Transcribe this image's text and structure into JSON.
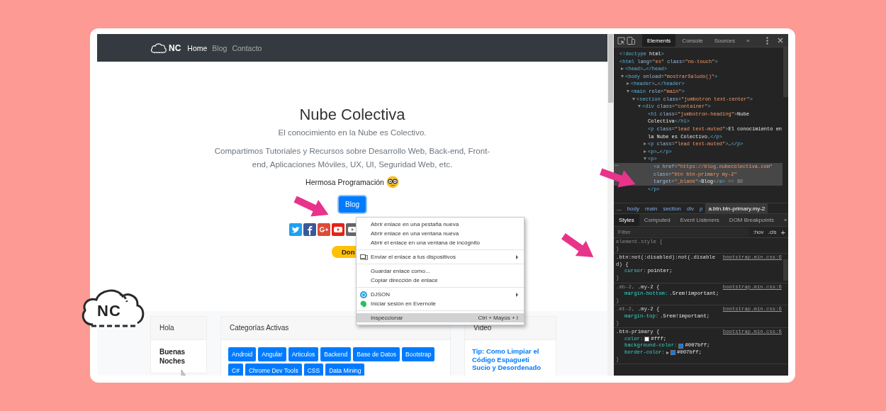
{
  "browser_page": {
    "navbar": {
      "logo_text": "NC",
      "links": [
        {
          "label": "Home",
          "selected": true
        },
        {
          "label": "Blog",
          "selected": false
        },
        {
          "label": "Contacto",
          "selected": false
        }
      ]
    },
    "hero": {
      "title": "Nube Colectiva",
      "subtitle": "El conocimiento en la Nube es Colectivo.",
      "description": "Compartimos Tutoriales y Recursos sobre Desarrollo Web, Back-end, Front-end, Aplicaciones Móviles, UX, UI, Seguridad Web, etc.",
      "greeting": "Hermosa Programación",
      "blog_button": "Blog",
      "donate_button": "Don"
    },
    "cards": [
      {
        "kind": "text",
        "title": "Hola",
        "body": "Buenas Noches"
      },
      {
        "kind": "tags",
        "title": "Categorías Activas",
        "tags": [
          "Android",
          "Angular",
          "Articulos",
          "Backend",
          "Base de Datos",
          "Bootstrap",
          "C#",
          "Chrome Dev Tools",
          "CSS",
          "Data Mining"
        ]
      },
      {
        "kind": "link",
        "title": "Video",
        "link": "Tip: Como Limpiar el Código Espagueti Sucio y Desordenado"
      }
    ]
  },
  "context_menu": {
    "groups": [
      [
        {
          "label": "Abrir enlace en una pestaña nueva",
          "submenu": false,
          "selected": false
        },
        {
          "label": "Abrir enlace en una ventana nueva",
          "submenu": false,
          "selected": false
        },
        {
          "label": "Abrir el enlace en una ventana de incógnito",
          "submenu": false,
          "selected": false
        }
      ],
      [
        {
          "label": "Enviar el enlace a tus dispositivos",
          "submenu": true,
          "selected": false
        }
      ],
      [
        {
          "label": "Guardar enlace como...",
          "submenu": false,
          "selected": false
        },
        {
          "label": "Copiar dirección de enlace",
          "submenu": false,
          "selected": false
        }
      ],
      [
        {
          "label": "DJSON",
          "submenu": true,
          "selected": false
        },
        {
          "label": "Iniciar sesión en Evernote",
          "submenu": false,
          "selected": false
        }
      ],
      [
        {
          "label": "Inspeccionar",
          "shortcut": "Ctrl + Mayús + I",
          "submenu": false,
          "selected": true
        }
      ]
    ]
  },
  "devtools": {
    "tabs": [
      {
        "label": "Elements",
        "selected": true
      },
      {
        "label": "Console",
        "selected": false
      },
      {
        "label": "Sources",
        "selected": false
      }
    ],
    "more_tabs": "»",
    "dom_tree": [
      {
        "markup": "<!doctype html>",
        "selected": false
      },
      {
        "markup": "<html lang=\"es\" class=\"no-touch\">",
        "selected": false,
        "children": [
          {
            "markup": "<head>…</head>",
            "expanded": false,
            "selected": false
          },
          {
            "markup": "<body onload=\"mostrarSaludo()\">",
            "expanded": true,
            "selected": false,
            "children": [
              {
                "markup": "<header>…</header>",
                "expanded": false,
                "selected": false
              },
              {
                "markup": "<main role=\"main\">",
                "expanded": true,
                "selected": false,
                "children": [
                  {
                    "markup": "<section class=\"jumbotron text-center\">",
                    "expanded": true,
                    "selected": false,
                    "children": [
                      {
                        "markup": "<div class=\"container\">",
                        "expanded": true,
                        "selected": false,
                        "children": [
                          {
                            "markup": "<h1 class=\"jumbotron-heading\">Nube Colectiva</h1>",
                            "selected": false
                          },
                          {
                            "markup": "<p class=\"lead text-muted\">El conocimiento en la Nube es Colectivo.</p>",
                            "selected": false
                          },
                          {
                            "markup": "<p class=\"lead text-muted\">…</p>",
                            "expanded": false,
                            "selected": false
                          },
                          {
                            "markup": "<p>…</p>",
                            "expanded": false,
                            "selected": false
                          },
                          {
                            "markup": "<p>",
                            "expanded": true,
                            "selected": false,
                            "closing": "</p>",
                            "children": [
                              {
                                "markup": "<a href=\"https://blog.nubecolectiva.com\" class=\"btn btn-primary my-2\" target=\"_blank\">Blog</a>",
                                "console_ref": "== $0",
                                "selected": true
                              }
                            ]
                          }
                        ]
                      }
                    ]
                  }
                ]
              }
            ]
          }
        ]
      }
    ],
    "breadcrumbs": [
      {
        "label": "...",
        "selected": false
      },
      {
        "label": "body",
        "selected": false
      },
      {
        "label": "main",
        "selected": false
      },
      {
        "label": "section",
        "selected": false
      },
      {
        "label": "div",
        "selected": false
      },
      {
        "label": "p",
        "selected": false
      },
      {
        "label": "a.btn.btn-primary.my-2",
        "selected": true
      }
    ],
    "style_tabs": [
      {
        "label": "Styles",
        "selected": true
      },
      {
        "label": "Computed",
        "selected": false
      },
      {
        "label": "Event Listeners",
        "selected": false
      },
      {
        "label": "DOM Breakpoints",
        "selected": false
      }
    ],
    "more_style_tabs": "»",
    "filter": {
      "placeholder": "Filter",
      "hov": ":hov",
      "cls": ".cls",
      "add": "+"
    },
    "rules": [
      {
        "selector": [
          {
            "text": "element.style {",
            "matched": false
          }
        ],
        "close": "}"
      },
      {
        "selector": [
          {
            "text": ".btn:not(:disabled):not(.disabled) {",
            "matched": true
          }
        ],
        "source": "bootstrap.min.css:6",
        "declarations": [
          {
            "text": "cursor: pointer;",
            "swatch": false,
            "expandable": false
          }
        ],
        "close": "}"
      },
      {
        "selector": [
          {
            "text": ".mb-2,",
            "matched": false
          },
          {
            "text": ".my-2 {",
            "matched": true
          }
        ],
        "source": "bootstrap.min.css:6",
        "declarations": [
          {
            "text": "margin-bottom: .5rem!important;",
            "swatch": false,
            "expandable": false
          }
        ],
        "close": "}"
      },
      {
        "selector": [
          {
            "text": ".mt-2,",
            "matched": false
          },
          {
            "text": ".my-2 {",
            "matched": true
          }
        ],
        "source": "bootstrap.min.css:6",
        "declarations": [
          {
            "text": "margin-top: .5rem!important;",
            "swatch": false,
            "expandable": false
          }
        ],
        "close": "}"
      },
      {
        "selector": [
          {
            "text": ".btn-primary {",
            "matched": true
          }
        ],
        "source": "bootstrap.min.css:6",
        "declarations": [
          {
            "text": "color: #fff;",
            "swatch": true,
            "expandable": false
          },
          {
            "text": "background-color: #007bff;",
            "swatch": true,
            "expandable": false
          },
          {
            "text": "border-color: #007bff;",
            "swatch": true,
            "expandable": true
          }
        ],
        "close": "}"
      }
    ]
  },
  "logo_badge": {
    "text": "NC"
  }
}
